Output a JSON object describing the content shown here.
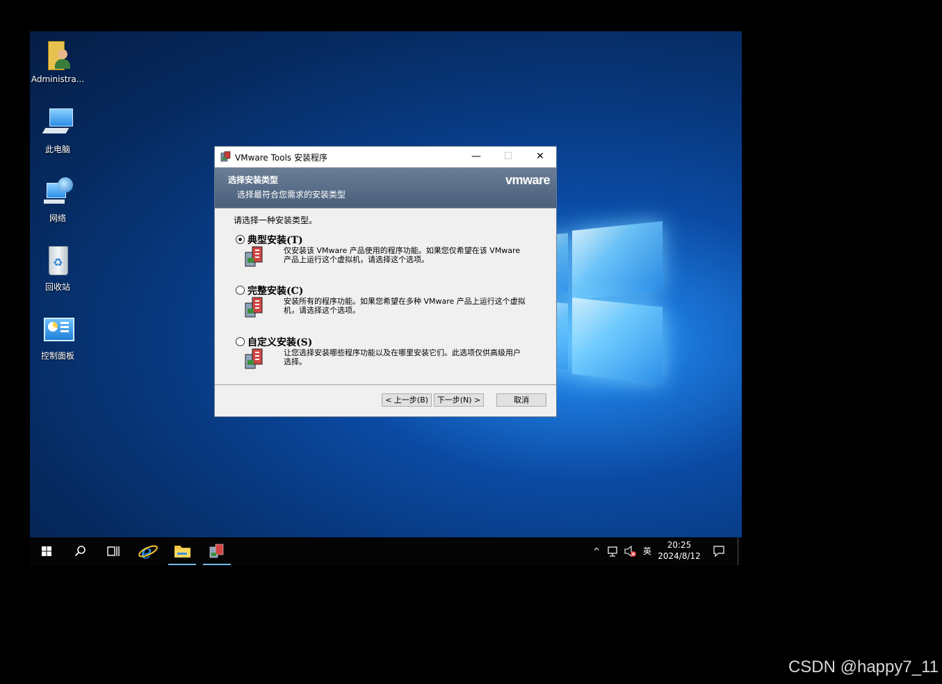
{
  "desktop": {
    "icons": [
      {
        "label": "Administra..."
      },
      {
        "label": "此电脑"
      },
      {
        "label": "网络"
      },
      {
        "label": "回收站"
      },
      {
        "label": "控制面板"
      }
    ]
  },
  "dialog": {
    "title": "VMware Tools 安装程序",
    "controls": {
      "minimize": "—",
      "maximize": "☐",
      "close": "✕"
    },
    "banner": {
      "heading": "选择安装类型",
      "subheading": "选择最符合您需求的安装类型",
      "logo": "vmware"
    },
    "prompt": "请选择一种安装类型。",
    "options": [
      {
        "title": "典型安装(T)",
        "description": "仅安装该 VMware 产品使用的程序功能。如果您仅希望在该 VMware 产品上运行这个虚拟机，请选择这个选项。",
        "selected": true
      },
      {
        "title": "完整安装(C)",
        "description": "安装所有的程序功能。如果您希望在多种 VMware 产品上运行这个虚拟机，请选择这个选项。",
        "selected": false
      },
      {
        "title": "自定义安装(S)",
        "description": "让您选择安装哪些程序功能以及在哪里安装它们。此选项仅供高级用户选择。",
        "selected": false
      }
    ],
    "buttons": {
      "back": "< 上一步(B)",
      "next": "下一步(N) >",
      "cancel": "取消"
    }
  },
  "taskbar": {
    "tray": {
      "ime": "英",
      "time": "20:25",
      "date": "2024/8/12"
    }
  },
  "watermark": "CSDN @happy7_11"
}
